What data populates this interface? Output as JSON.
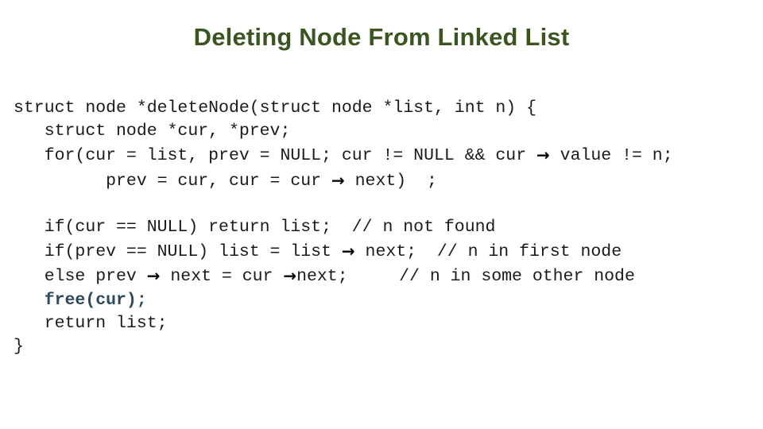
{
  "slide": {
    "title": "Deleting Node From Linked List",
    "title_color": "#3a5520",
    "background_color": "#ffffff",
    "code_color": "#1a1a1a",
    "highlight_color": "#2c4a5c",
    "arrow_glyph": "→"
  },
  "code": {
    "lines": [
      {
        "id": "line-signature",
        "segments": [
          {
            "text": "struct node *deleteNode(struct node *list, int n) {",
            "style": "plain"
          }
        ]
      },
      {
        "id": "line-declare-vars",
        "segments": [
          {
            "text": "   struct node *cur, *prev;",
            "style": "plain"
          }
        ]
      },
      {
        "id": "line-for-header",
        "segments": [
          {
            "text": "   for(cur = list, prev = NULL; cur != NULL && cur ",
            "style": "plain"
          },
          {
            "text": "→",
            "style": "arrow"
          },
          {
            "text": " value != n;",
            "style": "plain"
          }
        ]
      },
      {
        "id": "line-for-update",
        "segments": [
          {
            "text": "         prev = cur, cur = cur ",
            "style": "plain"
          },
          {
            "text": "→",
            "style": "arrow"
          },
          {
            "text": " next)  ;",
            "style": "plain"
          }
        ]
      },
      {
        "id": "line-blank",
        "segments": []
      },
      {
        "id": "line-if-cur-null",
        "segments": [
          {
            "text": "   if(cur == NULL) return list;  // n not found",
            "style": "plain"
          }
        ]
      },
      {
        "id": "line-if-prev-null",
        "segments": [
          {
            "text": "   if(prev == NULL) list = list ",
            "style": "plain"
          },
          {
            "text": "→",
            "style": "arrow"
          },
          {
            "text": " next;  // n in first node",
            "style": "plain"
          }
        ]
      },
      {
        "id": "line-else-branch",
        "segments": [
          {
            "text": "   else prev ",
            "style": "plain"
          },
          {
            "text": "→",
            "style": "arrow"
          },
          {
            "text": " next = cur ",
            "style": "plain"
          },
          {
            "text": "→",
            "style": "arrow"
          },
          {
            "text": "next;     // n in some other node",
            "style": "plain"
          }
        ]
      },
      {
        "id": "line-free-cur",
        "segments": [
          {
            "text": "   ",
            "style": "plain"
          },
          {
            "text": "free(cur);",
            "style": "free"
          }
        ]
      },
      {
        "id": "line-return-list",
        "segments": [
          {
            "text": "   return list;",
            "style": "plain"
          }
        ]
      },
      {
        "id": "line-close-brace",
        "segments": [
          {
            "text": "}",
            "style": "plain"
          }
        ]
      }
    ]
  }
}
